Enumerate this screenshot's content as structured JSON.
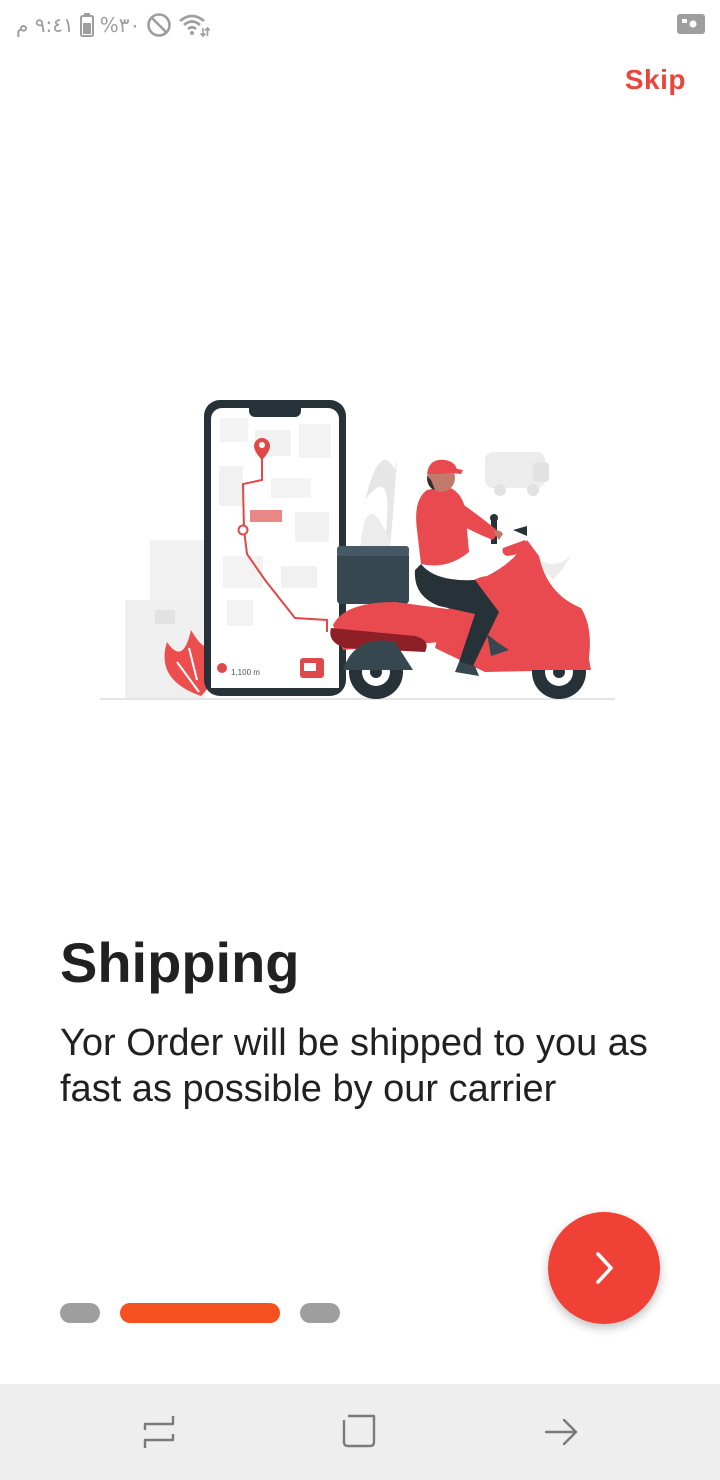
{
  "status_bar": {
    "time": "٩:٤١ م",
    "battery_percent": "%٣٠",
    "icons": [
      "battery-icon",
      "do-not-disturb-icon",
      "wifi-icon",
      "video-camera-icon"
    ]
  },
  "onboarding": {
    "skip_label": "Skip",
    "illustration": {
      "phone_distance": "1,100 m"
    },
    "title": "Shipping",
    "description": "Yor Order will be shipped to you as fast as possible by our carrier",
    "page_index": 1,
    "page_count": 3,
    "next_icon": "chevron-right-icon"
  },
  "colors": {
    "accent": "#ef4136",
    "skip": "#e8473d",
    "indicator_active": "#f4511e",
    "indicator_inactive": "#9e9e9e",
    "nav_bar": "#eeeeee"
  },
  "nav_bar": {
    "icons": [
      "recent-apps-icon",
      "home-icon",
      "back-icon"
    ]
  }
}
